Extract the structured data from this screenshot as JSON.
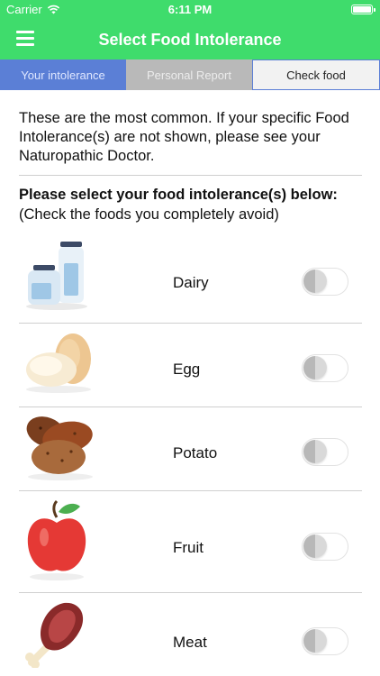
{
  "status_bar": {
    "carrier": "Carrier",
    "time": "6:11 PM"
  },
  "nav": {
    "title": "Select Food Intolerance",
    "menu_icon": "hamburger-menu-icon"
  },
  "tabs": [
    {
      "label": "Your intolerance"
    },
    {
      "label": "Personal Report"
    },
    {
      "label": "Check food"
    }
  ],
  "intro": {
    "text": "These are the most common. If your specific Food Intolerance(s) are not shown, please see your Naturopathic Doctor."
  },
  "instructions": {
    "heading": "Please select your food intolerance(s) below:",
    "subheading": "(Check the foods you completely avoid)"
  },
  "foods": [
    {
      "name": "Dairy",
      "icon": "dairy-bottles-icon",
      "selected": false
    },
    {
      "name": "Egg",
      "icon": "eggs-icon",
      "selected": false
    },
    {
      "name": "Potato",
      "icon": "potatoes-icon",
      "selected": false
    },
    {
      "name": "Fruit",
      "icon": "apple-icon",
      "selected": false
    },
    {
      "name": "Meat",
      "icon": "meat-drumstick-icon",
      "selected": false
    }
  ],
  "colors": {
    "header_green": "#3fdc6c",
    "tab_active_blue": "#5b7fd6",
    "tab_inactive_gray": "#b9b9b9"
  }
}
